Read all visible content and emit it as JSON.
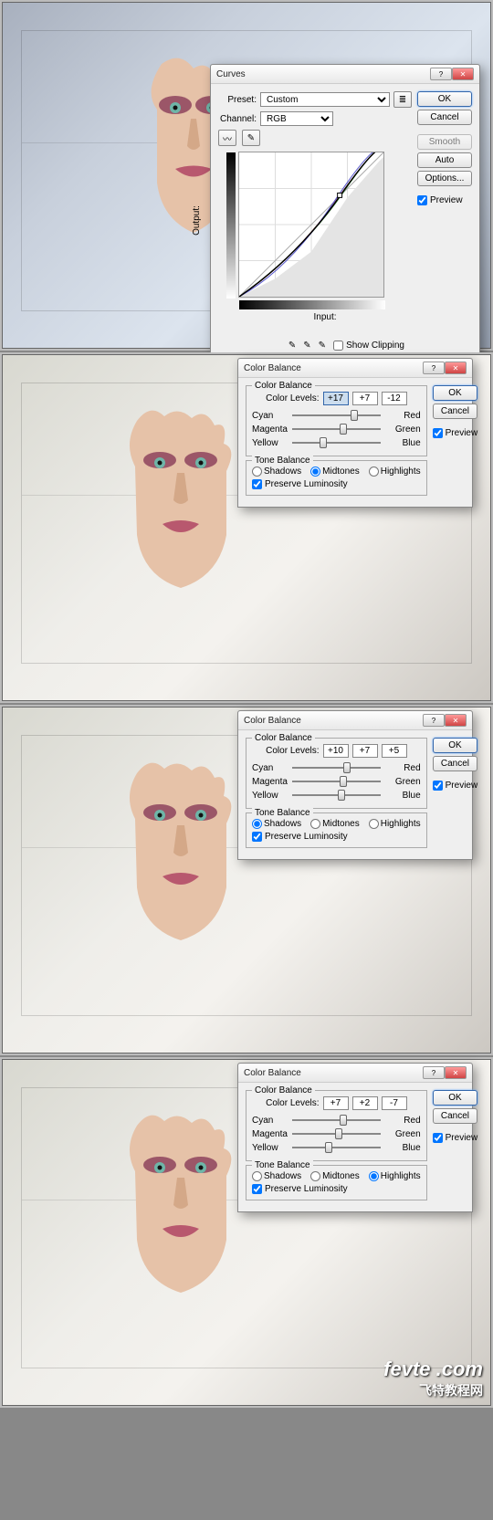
{
  "curves": {
    "title": "Curves",
    "preset_label": "Preset:",
    "preset_value": "Custom",
    "channel_label": "Channel:",
    "channel_value": "RGB",
    "output_label": "Output:",
    "input_label": "Input:",
    "show_clipping": "Show Clipping",
    "expand": "Curve Display Options",
    "buttons": {
      "ok": "OK",
      "cancel": "Cancel",
      "smooth": "Smooth",
      "auto": "Auto",
      "options": "Options..."
    },
    "preview": "Preview"
  },
  "cb": {
    "title": "Color Balance",
    "group1": "Color Balance",
    "group2": "Tone Balance",
    "levels_label": "Color Levels:",
    "labels": {
      "cyan": "Cyan",
      "red": "Red",
      "magenta": "Magenta",
      "green": "Green",
      "yellow": "Yellow",
      "blue": "Blue"
    },
    "tones": {
      "shadows": "Shadows",
      "midtones": "Midtones",
      "highlights": "Highlights"
    },
    "preserve": "Preserve Luminosity",
    "buttons": {
      "ok": "OK",
      "cancel": "Cancel"
    },
    "preview": "Preview"
  },
  "cb_instances": [
    {
      "levels": [
        "+17",
        "+7",
        "-12"
      ],
      "selected_input": 0,
      "tone": "midtones"
    },
    {
      "levels": [
        "+10",
        "+7",
        "+5"
      ],
      "selected_input": -1,
      "tone": "shadows"
    },
    {
      "levels": [
        "+7",
        "+2",
        "-7"
      ],
      "selected_input": -1,
      "tone": "highlights"
    }
  ],
  "watermark": {
    "url": "fevte .com",
    "cn": "飞特教程网"
  }
}
